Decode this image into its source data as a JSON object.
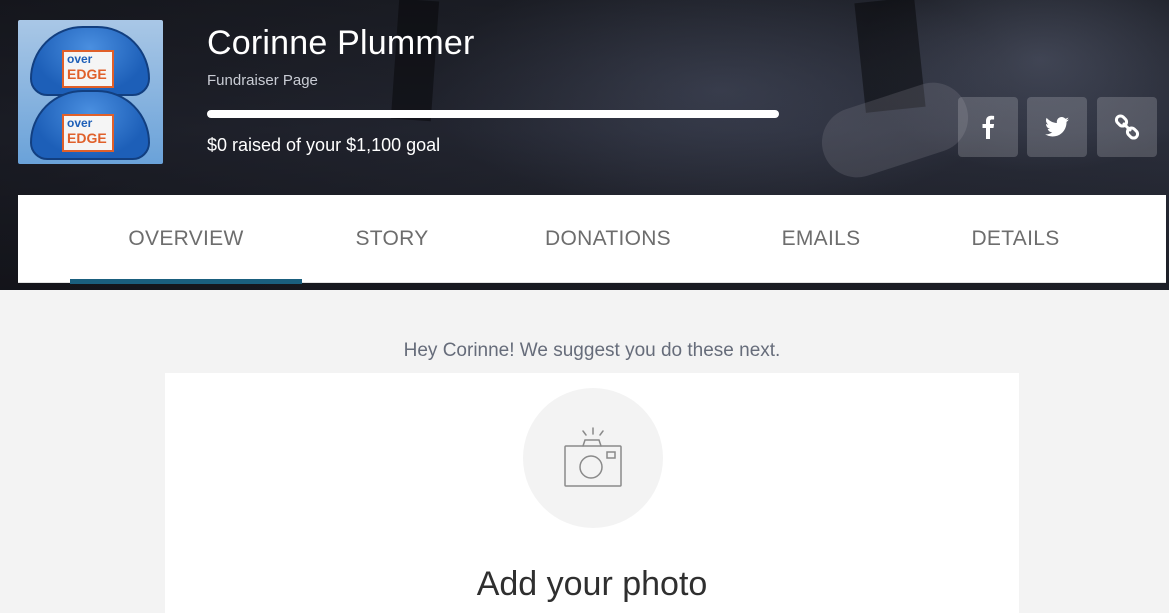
{
  "header": {
    "name": "Corinne Plummer",
    "page_type": "Fundraiser Page",
    "raised_text": "$0 raised of your $1,100 goal",
    "progress_fraction": 0,
    "avatar_sticker_top": "over",
    "avatar_sticker_bottom": "EDGE",
    "share_buttons": [
      {
        "icon": "facebook-icon"
      },
      {
        "icon": "twitter-icon"
      },
      {
        "icon": "link-icon"
      }
    ]
  },
  "tabs": [
    {
      "label": "OVERVIEW",
      "active": true
    },
    {
      "label": "STORY",
      "active": false
    },
    {
      "label": "DONATIONS",
      "active": false
    },
    {
      "label": "EMAILS",
      "active": false
    },
    {
      "label": "DETAILS",
      "active": false
    }
  ],
  "main": {
    "suggestion": "Hey Corinne! We suggest you do these next.",
    "card": {
      "icon": "camera-icon",
      "title": "Add your photo"
    }
  },
  "colors": {
    "accent": "#1a5f7e",
    "progress_fill": "#2c7ea6",
    "page_background": "#f3f3f3"
  }
}
